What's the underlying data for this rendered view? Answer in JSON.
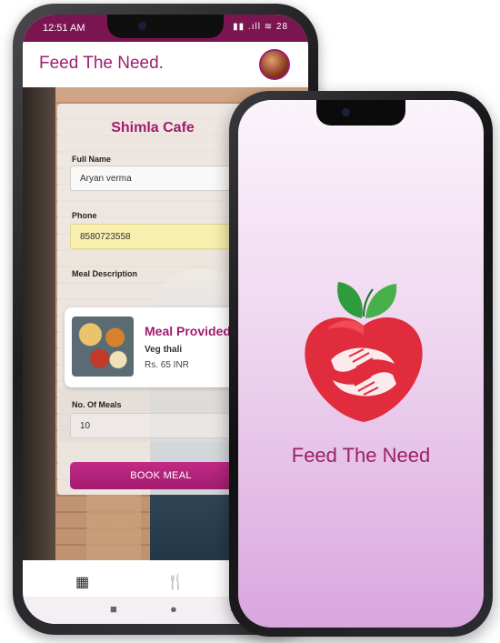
{
  "back_phone": {
    "status_bar": {
      "time": "12:51 AM",
      "icons": "▮▮ .ıll ≋ 28"
    },
    "app_title": "Feed The Need.",
    "form": {
      "cafe_name": "Shimla Cafe",
      "full_name_label": "Full Name",
      "full_name_value": "Aryan verma",
      "phone_label": "Phone",
      "phone_value": "8580723558",
      "meal_desc_label": "Meal Description",
      "meals_label": "No. Of Meals",
      "meals_value": "10",
      "book_button": "BOOK MEAL"
    },
    "meal_card": {
      "title": "Meal Provided",
      "item": "Veg thali",
      "price": "Rs. 65 INR"
    },
    "bottom_nav": {
      "dashboard_icon": "▦",
      "meals_icon": "🍴"
    },
    "system_nav": {
      "recent": "■",
      "home": "●",
      "back": "◀"
    }
  },
  "front_phone": {
    "tagline": "Feed The Need"
  },
  "colors": {
    "brand": "#a11c70",
    "status_bar": "#7a1552",
    "apple_red": "#e02c3c",
    "leaf_green": "#2f8f3a"
  }
}
